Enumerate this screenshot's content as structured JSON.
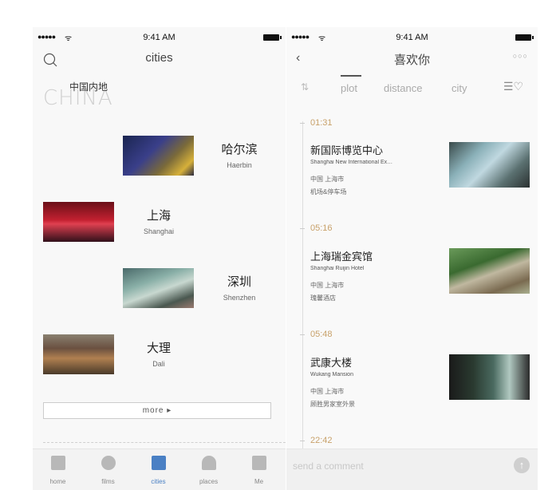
{
  "left_screen": {
    "status": {
      "signal": "●●●●●",
      "wifi": "ᯤ",
      "time": "9:41 AM"
    },
    "title": "cities",
    "region_label": "中国内地",
    "region_watermark": "CHINA",
    "cities": [
      {
        "name": "哈尔滨",
        "name_en": "Haerbin"
      },
      {
        "name": "上海",
        "name_en": "Shanghai"
      },
      {
        "name": "深圳",
        "name_en": "Shenzhen"
      },
      {
        "name": "大理",
        "name_en": "Dali"
      }
    ],
    "more_label": "more ▸",
    "tabs": [
      {
        "label": "home",
        "icon": "home-icon"
      },
      {
        "label": "films",
        "icon": "film-reel-icon"
      },
      {
        "label": "cities",
        "icon": "cities-icon",
        "active": true
      },
      {
        "label": "places",
        "icon": "person-icon"
      },
      {
        "label": "Me",
        "icon": "briefcase-icon"
      }
    ],
    "accent_color": "#4a80c4"
  },
  "right_screen": {
    "status": {
      "signal": "●●●●●",
      "wifi": "ᯤ",
      "time": "9:41 AM"
    },
    "back_glyph": "‹",
    "title": "喜欢你",
    "more_glyph": "○○○",
    "sort_glyph": "⇅",
    "filters": [
      "plot",
      "distance",
      "city"
    ],
    "active_filter": "plot",
    "favorites_glyph": "☰♡",
    "scenes": [
      {
        "time": "01:31",
        "title": "新国际博览中心",
        "title_en": "Shanghai New International Ex…",
        "city": "中国 上海市",
        "place": "机场&停车场"
      },
      {
        "time": "05:16",
        "title": "上海瑞金宾馆",
        "title_en": "Shanghai Ruijin Hotel",
        "city": "中国 上海市",
        "place": "瑰馨酒店"
      },
      {
        "time": "05:48",
        "title": "武康大楼",
        "title_en": "Wukang Mansion",
        "city": "中国 上海市",
        "place": "顾胜男家室外景"
      },
      {
        "time": "22:42"
      }
    ],
    "comment_placeholder": "send a comment",
    "send_glyph": "↑",
    "time_color": "#c8a16a"
  }
}
